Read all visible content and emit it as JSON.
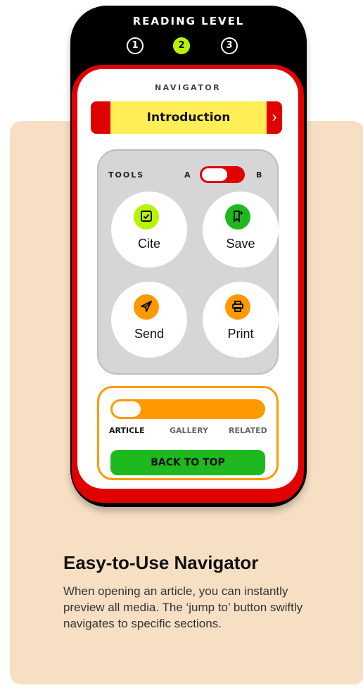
{
  "reading_level": {
    "title": "READING LEVEL",
    "levels": [
      "1",
      "2",
      "3"
    ],
    "selected": "2"
  },
  "navigator": {
    "label": "NAVIGATOR",
    "current_section": "Introduction"
  },
  "tools": {
    "label": "TOOLS",
    "toggle_a": "A",
    "toggle_b": "B",
    "items": [
      {
        "label": "Cite",
        "icon": "check-square-icon",
        "color": "#b7f400"
      },
      {
        "label": "Save",
        "icon": "bookmark-add-icon",
        "color": "#1fb81f"
      },
      {
        "label": "Send",
        "icon": "paper-plane-icon",
        "color": "#ff9900"
      },
      {
        "label": "Print",
        "icon": "printer-icon",
        "color": "#ff9900"
      }
    ]
  },
  "media_tabs": {
    "tabs": [
      "ARTICLE",
      "GALLERY",
      "RELATED"
    ],
    "active": "ARTICLE"
  },
  "back_to_top": "BACK TO TOP",
  "feature": {
    "heading": "Easy-to-Use Navigator",
    "description": "When opening an article, you can instantly preview all media. The ‘jump to’ button swiftly navigates to specific sections."
  },
  "colors": {
    "card_bg": "#f7dfc4",
    "red": "#e00000",
    "yellow": "#ffee55",
    "lime": "#b7f400",
    "green": "#1fb81f",
    "orange": "#ff9900"
  }
}
